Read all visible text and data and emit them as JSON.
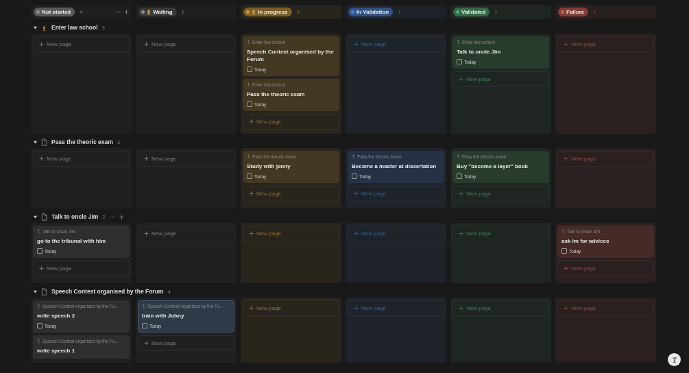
{
  "columns": [
    {
      "label": "Not started",
      "count": "4",
      "color": "#8f8f8f",
      "has_icon": false,
      "show_actions": true
    },
    {
      "label": "Waiting",
      "count": "1",
      "color": "#8f8f8f",
      "has_icon": true,
      "show_actions": false
    },
    {
      "label": "In progress",
      "count": "3",
      "color": "#d49a2c",
      "has_icon": true,
      "show_actions": false
    },
    {
      "label": "In Validation",
      "count": "1",
      "color": "#3f7fe0",
      "has_icon": false,
      "show_actions": false
    },
    {
      "label": "Validated",
      "count": "2",
      "color": "#4caf6b",
      "has_icon": false,
      "show_actions": false
    },
    {
      "label": "Failure",
      "count": "1",
      "color": "#e0574d",
      "has_icon": false,
      "show_actions": false
    }
  ],
  "groups": [
    {
      "title": "Enter law school",
      "count": "3",
      "has_emoji": true,
      "expanded": true,
      "show_actions": false,
      "cells": [
        {
          "new_page": "New page"
        },
        {
          "new_page": "New page"
        },
        {
          "new_page": "New page",
          "cards": [
            {
              "parent": "Enter law school",
              "title": "Speech Contest organised by the Forum",
              "date": "Today",
              "checked": false,
              "selected": false
            },
            {
              "parent": "Enter law school",
              "title": "Pass the theoric exam",
              "date": "Today",
              "checked": false,
              "selected": false
            }
          ]
        },
        {
          "new_page": "New page"
        },
        {
          "new_page": "New page",
          "cards": [
            {
              "parent": "Enter law school",
              "title": "Talk to oncle Jim",
              "date": "Today",
              "checked": false,
              "selected": false
            }
          ]
        },
        {
          "new_page": "New page"
        }
      ]
    },
    {
      "title": "Pass the theoric exam",
      "count": "3",
      "has_emoji": false,
      "expanded": true,
      "show_actions": false,
      "cells": [
        {
          "new_page": "New page"
        },
        {
          "new_page": "New page"
        },
        {
          "new_page": "New page",
          "cards": [
            {
              "parent": "Pass the theoric exam",
              "title": "Study with jenny",
              "date": "Today",
              "checked": false,
              "selected": false
            }
          ]
        },
        {
          "new_page": "New page",
          "cards": [
            {
              "parent": "Pass the theoric exam",
              "title": "Become a master at dissertation",
              "date": "Today",
              "checked": false,
              "selected": false
            }
          ]
        },
        {
          "new_page": "New page",
          "cards": [
            {
              "parent": "Pass the theoric exam",
              "title": "Buy \"become a layer\" book",
              "date": "Today",
              "checked": false,
              "selected": false
            }
          ]
        },
        {
          "new_page": "New page"
        }
      ]
    },
    {
      "title": "Talk to oncle Jim",
      "count": "2",
      "has_emoji": false,
      "expanded": true,
      "show_actions": true,
      "cells": [
        {
          "new_page": "New page",
          "cards": [
            {
              "parent": "Talk to oncle Jim",
              "title": "go to the tribunal with him",
              "date": "Today",
              "checked": false,
              "selected": false
            }
          ]
        },
        {
          "new_page": "New page"
        },
        {
          "new_page": "New page"
        },
        {
          "new_page": "New page"
        },
        {
          "new_page": "New page"
        },
        {
          "new_page": "New page",
          "cards": [
            {
              "parent": "Talk to oncle Jim",
              "title": "ask im for advices",
              "date": "Today",
              "checked": false,
              "selected": false
            }
          ]
        }
      ]
    },
    {
      "title": "Speech Contest organised by the Forum",
      "count": "4",
      "has_emoji": false,
      "expanded": true,
      "show_actions": false,
      "cells": [
        {
          "cards": [
            {
              "parent": "Speech Contest organised by the Fo...",
              "title": "write speech 2",
              "date": "Today",
              "checked": false,
              "selected": false
            },
            {
              "parent": "Speech Contest organised by the Fo...",
              "title": "write speech 1",
              "selected": false
            }
          ]
        },
        {
          "new_page": "New page",
          "cards": [
            {
              "parent": "Speech Contest organised by the Fo...",
              "title": "train with Johny",
              "date": "Today",
              "checked": false,
              "selected": true
            }
          ]
        },
        {
          "new_page": "New page"
        },
        {
          "new_page": "New page"
        },
        {
          "new_page": "New page"
        },
        {
          "new_page": "New page"
        }
      ]
    }
  ]
}
